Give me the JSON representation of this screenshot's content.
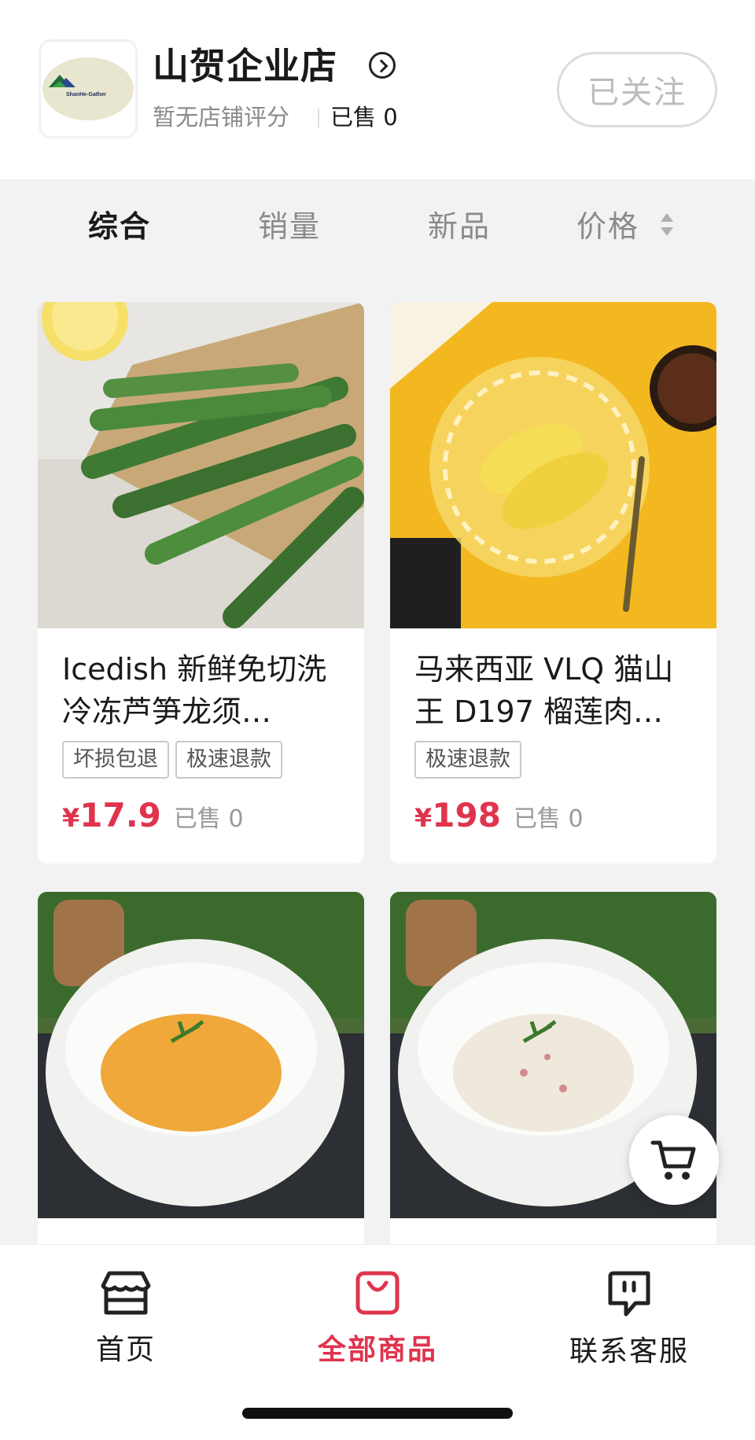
{
  "shop": {
    "name": "山贺企业店",
    "rating_text": "暂无店铺评分",
    "sold_text": "已售 0",
    "follow_label": "已关注",
    "logo_text": "ShanHe-Gather"
  },
  "sort_tabs": [
    {
      "label": "综合",
      "active": true
    },
    {
      "label": "销量",
      "active": false
    },
    {
      "label": "新品",
      "active": false
    },
    {
      "label": "价格",
      "active": false
    }
  ],
  "products": [
    {
      "title": "Icedish 新鲜免切洗冷冻芦笋龙须…",
      "tags": [
        "坏损包退",
        "极速退款"
      ],
      "price_symbol": "¥",
      "price": "17.9",
      "sold": "已售 0",
      "image": "asparagus"
    },
    {
      "title": "马来西亚 VLQ 猫山王 D197 榴莲肉…",
      "tags": [
        "极速退款"
      ],
      "price_symbol": "¥",
      "price": "198",
      "sold": "已售 0",
      "image": "durian"
    },
    {
      "title": "",
      "image": "pumpkin-puree"
    },
    {
      "title": "",
      "image": "mashed-potato"
    }
  ],
  "bottom_nav": [
    {
      "label": "首页",
      "icon": "store-icon",
      "active": false
    },
    {
      "label": "全部商品",
      "icon": "bag-icon",
      "active": true
    },
    {
      "label": "联系客服",
      "icon": "chat-icon",
      "active": false
    }
  ],
  "colors": {
    "accent": "#e0344e",
    "background": "#f2f2f2"
  }
}
